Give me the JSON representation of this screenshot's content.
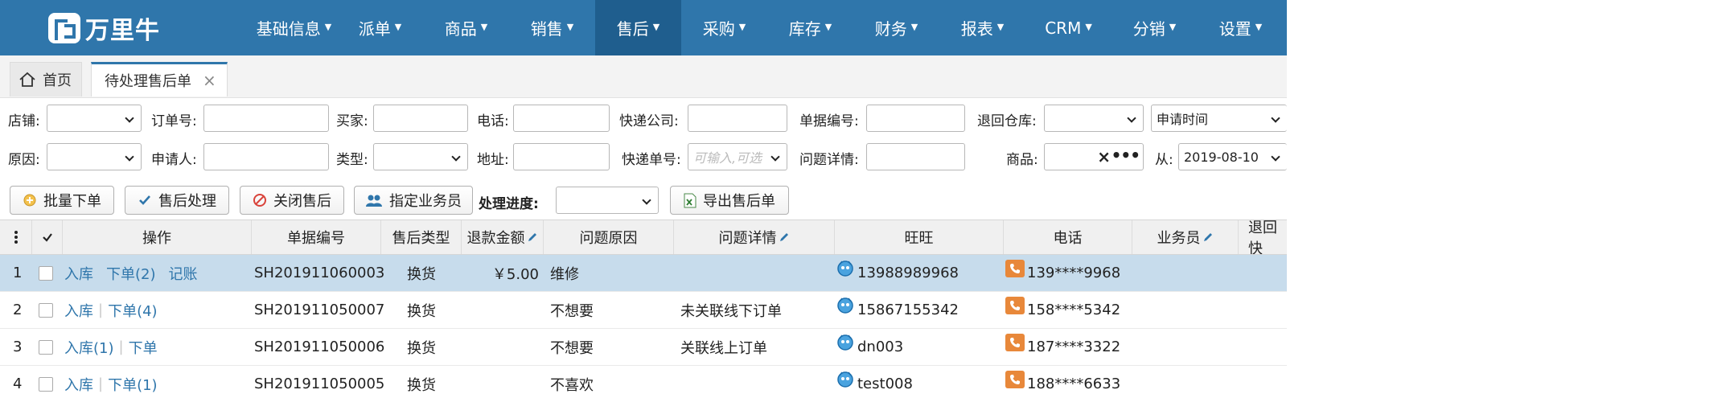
{
  "brand": {
    "name": "万里牛"
  },
  "nav": [
    {
      "label": "基础信息"
    },
    {
      "label": "派单"
    },
    {
      "label": "商品"
    },
    {
      "label": "销售"
    },
    {
      "label": "售后",
      "active": true
    },
    {
      "label": "采购"
    },
    {
      "label": "库存"
    },
    {
      "label": "财务"
    },
    {
      "label": "报表"
    },
    {
      "label": "CRM"
    },
    {
      "label": "分销"
    },
    {
      "label": "设置"
    }
  ],
  "tabs": {
    "home": "首页",
    "current": "待处理售后单"
  },
  "filters": {
    "shop": "店铺:",
    "order_no": "订单号:",
    "buyer": "买家:",
    "phone": "电话:",
    "courier": "快递公司:",
    "doc_no": "单据编号:",
    "return_wh": "退回仓库:",
    "date_type_value": "申请时间",
    "reason": "原因:",
    "applicant": "申请人:",
    "type": "类型:",
    "address": "地址:",
    "tracking_no": "快递单号:",
    "tracking_placeholder": "可输入,可选",
    "issue_detail": "问题详情:",
    "product": "商品:",
    "from": "从:",
    "from_value": "2019-08-10"
  },
  "toolbar": {
    "batch": "批量下单",
    "process": "售后处理",
    "close": "关闭售后",
    "assign": "指定业务员",
    "progress_label": "处理进度:",
    "export": "导出售后单"
  },
  "columns": {
    "action": "操作",
    "doc_no": "单据编号",
    "type": "售后类型",
    "refund": "退款金额",
    "reason": "问题原因",
    "detail": "问题详情",
    "wangwang": "旺旺",
    "phone": "电话",
    "staff": "业务员",
    "return": "退回快"
  },
  "rows": [
    {
      "idx": "1",
      "links": [
        "入库",
        "下单(2)",
        "记账"
      ],
      "doc_no": "SH201911060003",
      "type": "换货",
      "refund": "￥5.00",
      "reason": "维修",
      "detail": "",
      "wangwang": "13988989968",
      "phone": "139****9968"
    },
    {
      "idx": "2",
      "links": [
        "入库",
        "下单(4)"
      ],
      "doc_no": "SH201911050007",
      "type": "换货",
      "refund": "",
      "reason": "不想要",
      "detail": "未关联线下订单",
      "wangwang": "15867155342",
      "phone": "158****5342"
    },
    {
      "idx": "3",
      "links": [
        "入库(1)",
        "下单"
      ],
      "doc_no": "SH201911050006",
      "type": "换货",
      "refund": "",
      "reason": "不想要",
      "detail": "关联线上订单",
      "wangwang": "dn003",
      "phone": "187****3322"
    },
    {
      "idx": "4",
      "links": [
        "入库",
        "下单(1)"
      ],
      "doc_no": "SH201911050005",
      "type": "换货",
      "refund": "",
      "reason": "不喜欢",
      "detail": "",
      "wangwang": "test008",
      "phone": "188****6633"
    }
  ],
  "colors": {
    "nav_bg": "#2f76ab",
    "nav_active": "#1f5e8e",
    "link": "#2f76ab",
    "selected_row": "#c7dcec"
  }
}
